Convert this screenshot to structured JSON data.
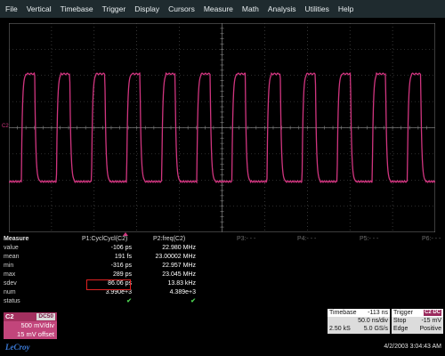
{
  "menu": [
    "File",
    "Vertical",
    "Timebase",
    "Trigger",
    "Display",
    "Cursors",
    "Measure",
    "Math",
    "Analysis",
    "Utilities",
    "Help"
  ],
  "trace": {
    "color": "#d0357f",
    "pulses": 12,
    "ground_marker": "C2"
  },
  "measure": {
    "title": "Measure",
    "columns": [
      {
        "label": "P1:CyclCycl(C2)",
        "active": true
      },
      {
        "label": "P2:freq(C2)",
        "active": true
      },
      {
        "label": "P3:- - -",
        "active": false
      },
      {
        "label": "P4:- - -",
        "active": false
      },
      {
        "label": "P5:- - -",
        "active": false
      },
      {
        "label": "P6:- - -",
        "active": false
      }
    ],
    "rows": [
      {
        "label": "value",
        "p1": "-106 ps",
        "p2": "22.980 MHz"
      },
      {
        "label": "mean",
        "p1": "191 fs",
        "p2": "23.00002 MHz"
      },
      {
        "label": "min",
        "p1": "-316 ps",
        "p2": "22.957 MHz"
      },
      {
        "label": "max",
        "p1": "289 ps",
        "p2": "23.045 MHz"
      },
      {
        "label": "sdev",
        "p1": "86.06 ps",
        "p2": "13.83 kHz"
      },
      {
        "label": "num",
        "p1": "3.990e+3",
        "p2": "4.389e+3"
      },
      {
        "label": "status",
        "p1": "✔",
        "p2": "✔"
      }
    ]
  },
  "channel": {
    "id": "C2",
    "coupling": "DC50",
    "scale": "500 mV/div",
    "offset": "15 mV offset"
  },
  "logo": "LeCroy",
  "timebase": {
    "title": "Timebase",
    "delay": "-113 ns",
    "rate": "50.0 ns/div",
    "samples": "2.50 kS",
    "sample_rate": "5.0 GS/s"
  },
  "trigger": {
    "title": "Trigger",
    "source_tag": "C2 DC",
    "mode": "Stop",
    "level": "-15 mV",
    "type": "Edge",
    "slope": "Positive"
  },
  "datetime": "4/2/2003 3:04:43 AM"
}
